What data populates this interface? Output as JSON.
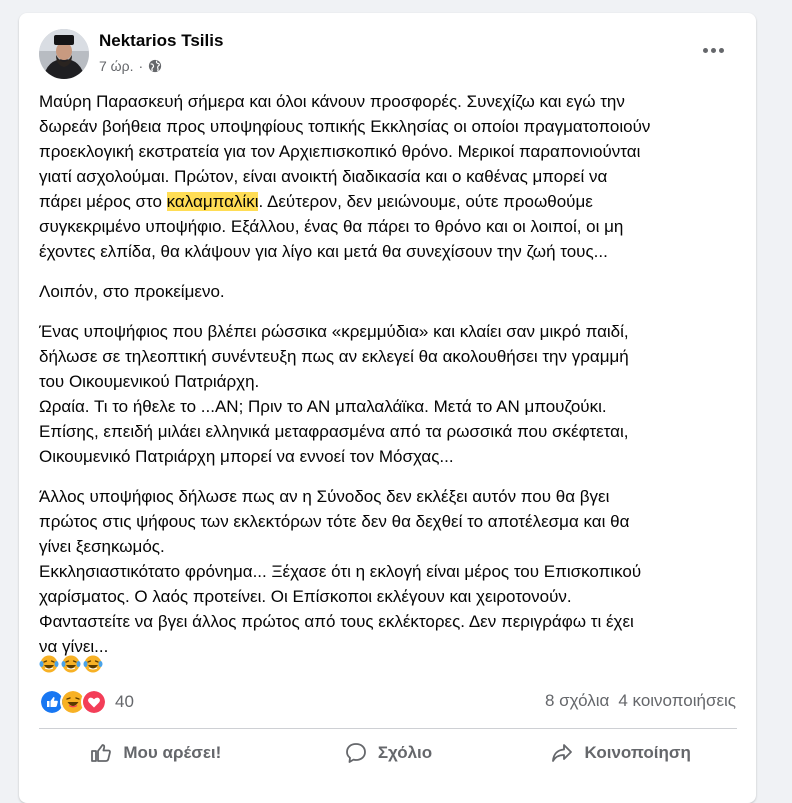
{
  "post": {
    "author": "Nektarios Tsilis",
    "time": "7 ώρ.",
    "dot": "·",
    "privacy_icon": "globe-icon",
    "more_icon": "more-options-icon",
    "paragraphs": [
      {
        "lines": [
          "Μαύρη Παρασκευή σήμερα και όλοι κάνουν προσφορές. Συνεχίζω και εγώ την",
          "δωρεάν βοήθεια προς υποψηφίους τοπικής Εκκλησίας οι οποίοι πραγματοποιούν",
          "προεκλογική εκστρατεία για τον Αρχιεπισκοπικό θρόνο. Μερικοί παραπονιούνται",
          "γιατί ασχολούμαι. Πρώτον, είναι ανοικτή διαδικασία και ο καθένας μπορεί να"
        ],
        "highlight_line": {
          "before": "πάρει μέρος στο ",
          "highlight": "καλαμπαλίκι",
          "after": ". Δεύτερον, δεν μειώνουμε, ούτε προωθούμε"
        },
        "lines_after": [
          "συγκεκριμένο υποψήφιο. Εξάλλου, ένας θα πάρει το θρόνο και οι λοιποί, οι μη",
          "έχοντες ελπίδα, θα κλάψουν για λίγο και μετά θα συνεχίσουν την ζωή τους..."
        ]
      },
      {
        "lines": [
          "Λοιπόν, στο προκείμενο."
        ]
      },
      {
        "lines": [
          "Ένας υποψήφιος που βλέπει ρώσσικα «κρεμμύδια» και κλαίει σαν μικρό παιδί,",
          "δήλωσε σε τηλεοπτική συνέντευξη πως αν εκλεγεί θα ακολουθήσει την γραμμή",
          "του Οικουμενικού Πατριάρχη.",
          "Ωραία. Τι το ήθελε το ...ΑΝ; Πριν το ΑΝ μπαλαλάϊκα. Μετά το ΑΝ μπουζούκι.",
          "Επίσης, επειδή μιλάει ελληνικά μεταφρασμένα από τα ρωσσικά που σκέφτεται,",
          "Οικουμενικό Πατριάρχη μπορεί να εννοεί τον Μόσχας..."
        ]
      },
      {
        "lines": [
          "Άλλος υποψήφιος δήλωσε πως αν η Σύνοδος δεν εκλέξει αυτόν που θα βγει",
          "πρώτος στις ψήφους των εκλεκτόρων τότε δεν θα δεχθεί το αποτέλεσμα και θα",
          "γίνει ξεσηκωμός.",
          "Εκκλησιαστικότατο φρόνημα... Ξέχασε ότι η εκλογή είναι μέρος του Επισκοπικού",
          "χαρίσματος. Ο λαός προτείνει. Οι Επίσκοποι εκλέγουν και χειροτονούν.",
          "Φανταστείτε να βγει άλλος πρώτος από τους εκλέκτορες. Δεν περιγράφω τι έχει",
          "να γίνει..."
        ]
      }
    ],
    "emojis": [
      "laughing-tears-emoji",
      "laughing-tears-emoji",
      "laughing-tears-emoji"
    ]
  },
  "stats": {
    "reaction_icons": [
      "like-reaction-icon",
      "haha-reaction-icon",
      "love-reaction-icon"
    ],
    "reaction_count": "40",
    "comments": "8 σχόλια",
    "shares": "4 κοινοποιήσεις"
  },
  "actions": {
    "like": "Μου αρέσει!",
    "comment": "Σχόλιο",
    "share": "Κοινοποίηση"
  },
  "colors": {
    "highlight": "#ffdd55",
    "like_blue": "#1877f2",
    "love_red": "#f33e58",
    "haha_yellow": "#f7b125",
    "muted_text": "#65676b"
  }
}
